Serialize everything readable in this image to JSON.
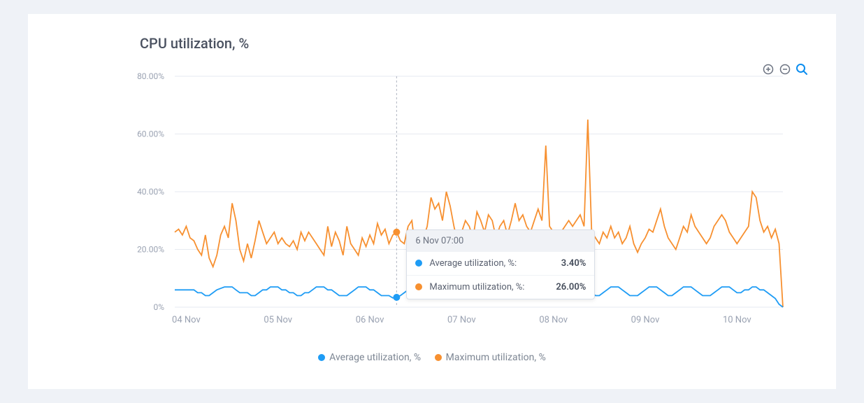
{
  "title": "CPU utilization, %",
  "colors": {
    "avg": "#1e9cf5",
    "max": "#f79030",
    "axis": "#9aa2b2"
  },
  "legend": {
    "avg": "Average utilization, %",
    "max": "Maximum utilization, %"
  },
  "tooltip": {
    "time_label": "6 Nov 07:00",
    "avg_label": "Average utilization, %:",
    "avg_value": "3.40%",
    "max_label": "Maximum utilization, %:",
    "max_value": "26.00%"
  },
  "chart_data": {
    "type": "line",
    "title": "CPU utilization, %",
    "xlabel": "",
    "ylabel": "",
    "ylim": [
      0,
      80
    ],
    "y_ticks": [
      "0%",
      "20.00%",
      "40.00%",
      "60.00%",
      "80.00%"
    ],
    "x_tick_labels": [
      "04 Nov",
      "05 Nov",
      "06 Nov",
      "07 Nov",
      "08 Nov",
      "09 Nov",
      "10 Nov"
    ],
    "x_tick_indices": [
      3,
      27,
      51,
      75,
      99,
      123,
      147
    ],
    "x": [
      0,
      1,
      2,
      3,
      4,
      5,
      6,
      7,
      8,
      9,
      10,
      11,
      12,
      13,
      14,
      15,
      16,
      17,
      18,
      19,
      20,
      21,
      22,
      23,
      24,
      25,
      26,
      27,
      28,
      29,
      30,
      31,
      32,
      33,
      34,
      35,
      36,
      37,
      38,
      39,
      40,
      41,
      42,
      43,
      44,
      45,
      46,
      47,
      48,
      49,
      50,
      51,
      52,
      53,
      54,
      55,
      56,
      57,
      58,
      59,
      60,
      61,
      62,
      63,
      64,
      65,
      66,
      67,
      68,
      69,
      70,
      71,
      72,
      73,
      74,
      75,
      76,
      77,
      78,
      79,
      80,
      81,
      82,
      83,
      84,
      85,
      86,
      87,
      88,
      89,
      90,
      91,
      92,
      93,
      94,
      95,
      96,
      97,
      98,
      99,
      100,
      101,
      102,
      103,
      104,
      105,
      106,
      107,
      108,
      109,
      110,
      111,
      112,
      113,
      114,
      115,
      116,
      117,
      118,
      119,
      120,
      121,
      122,
      123,
      124,
      125,
      126,
      127,
      128,
      129,
      130,
      131,
      132,
      133,
      134,
      135,
      136,
      137,
      138,
      139,
      140,
      141,
      142,
      143,
      144,
      145,
      146,
      147,
      148,
      149,
      150,
      151,
      152,
      153,
      154,
      155,
      156,
      157,
      158,
      159
    ],
    "hover_index": 58,
    "series": [
      {
        "name": "Average utilization, %",
        "color": "#1e9cf5",
        "values": [
          6,
          6,
          6,
          6,
          6,
          6,
          5,
          5,
          4,
          4,
          5,
          6,
          6.5,
          7,
          7,
          7,
          6,
          5,
          5,
          5,
          4,
          4,
          5,
          6,
          6,
          7,
          7,
          7,
          6,
          6,
          5,
          5,
          4,
          4,
          5,
          5,
          6,
          7,
          7,
          7,
          6,
          6,
          5,
          4,
          4,
          4,
          5,
          6,
          7,
          7,
          7,
          6,
          6,
          5,
          4,
          4,
          4,
          3.2,
          3.4,
          4,
          5,
          6,
          7,
          7,
          7,
          6,
          5,
          5,
          4,
          4,
          4,
          5,
          5,
          6,
          7,
          7,
          7,
          6,
          5,
          4,
          4,
          4,
          5,
          6,
          7,
          7,
          7,
          6,
          5,
          4,
          4,
          4,
          5,
          6,
          7,
          7,
          7,
          6,
          5,
          4,
          4,
          4,
          5,
          6,
          7,
          7,
          7,
          6,
          5,
          5,
          4,
          4,
          5,
          6,
          7,
          7,
          7,
          6,
          5,
          4,
          4,
          4,
          5,
          6,
          7,
          7,
          7,
          6,
          5,
          4,
          4,
          5,
          6,
          7,
          7,
          7,
          6,
          5,
          4,
          4,
          4,
          5,
          6,
          7,
          7,
          7,
          6,
          5,
          5,
          6,
          6,
          7,
          7,
          6,
          6,
          5,
          4,
          3,
          1,
          0
        ]
      },
      {
        "name": "Maximum utilization, %",
        "color": "#f79030",
        "values": [
          26,
          27,
          25,
          28,
          24,
          23,
          20,
          18,
          25,
          17,
          14,
          18,
          25,
          28,
          24,
          36,
          30,
          20,
          16,
          22,
          17,
          23,
          30,
          26,
          22,
          24,
          26,
          22,
          24,
          22,
          21,
          23,
          20,
          26,
          23,
          26,
          24,
          22,
          20,
          18,
          28,
          21,
          26,
          23,
          18,
          28,
          22,
          20,
          18,
          24,
          21,
          25,
          22,
          29,
          25,
          27,
          22,
          25,
          26,
          23,
          22,
          28,
          30,
          19,
          18,
          24,
          28,
          38,
          34,
          36,
          30,
          40,
          35,
          28,
          22,
          26,
          30,
          28,
          24,
          33,
          30,
          26,
          32,
          30,
          24,
          28,
          30,
          25,
          30,
          36,
          30,
          32,
          28,
          26,
          30,
          34,
          30,
          56,
          28,
          26,
          24,
          26,
          28,
          30,
          28,
          30,
          32,
          28,
          65,
          26,
          24,
          22,
          26,
          24,
          28,
          24,
          26,
          22,
          24,
          28,
          22,
          19,
          22,
          24,
          27,
          26,
          30,
          34,
          28,
          24,
          22,
          20,
          24,
          28,
          26,
          32,
          28,
          26,
          24,
          22,
          24,
          28,
          30,
          32,
          30,
          26,
          24,
          22,
          24,
          26,
          28,
          40,
          38,
          30,
          26,
          28,
          24,
          27,
          22,
          0
        ]
      }
    ]
  }
}
